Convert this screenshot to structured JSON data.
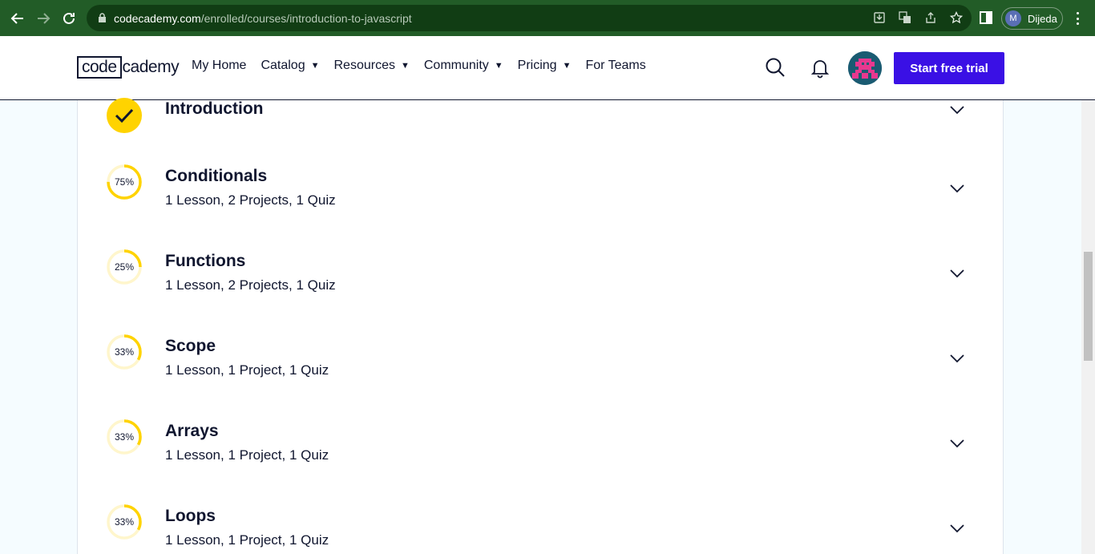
{
  "browser": {
    "url_host": "codecademy.com",
    "url_path": "/enrolled/courses/introduction-to-javascript",
    "profile_initial": "M",
    "profile_name": "Dijeda"
  },
  "header": {
    "logo_code": "code",
    "logo_rest": "cademy",
    "nav": [
      {
        "label": "My Home",
        "dropdown": false
      },
      {
        "label": "Catalog",
        "dropdown": true
      },
      {
        "label": "Resources",
        "dropdown": true
      },
      {
        "label": "Community",
        "dropdown": true
      },
      {
        "label": "Pricing",
        "dropdown": true
      },
      {
        "label": "For Teams",
        "dropdown": false
      }
    ],
    "cta_label": "Start free trial"
  },
  "colors": {
    "accent": "#3a10e5",
    "progress": "#ffd300",
    "progress_track": "#fff6cc",
    "text": "#10162f"
  },
  "modules": [
    {
      "title": "Introduction",
      "subtitle": "",
      "progress": 100,
      "complete": true
    },
    {
      "title": "Conditionals",
      "subtitle": "1 Lesson, 2 Projects, 1 Quiz",
      "progress": 75,
      "progress_label": "75%",
      "complete": false
    },
    {
      "title": "Functions",
      "subtitle": "1 Lesson, 2 Projects, 1 Quiz",
      "progress": 25,
      "progress_label": "25%",
      "complete": false
    },
    {
      "title": "Scope",
      "subtitle": "1 Lesson, 1 Project, 1 Quiz",
      "progress": 33,
      "progress_label": "33%",
      "complete": false
    },
    {
      "title": "Arrays",
      "subtitle": "1 Lesson, 1 Project, 1 Quiz",
      "progress": 33,
      "progress_label": "33%",
      "complete": false
    },
    {
      "title": "Loops",
      "subtitle": "1 Lesson, 1 Project, 1 Quiz",
      "progress": 33,
      "progress_label": "33%",
      "complete": false
    }
  ]
}
